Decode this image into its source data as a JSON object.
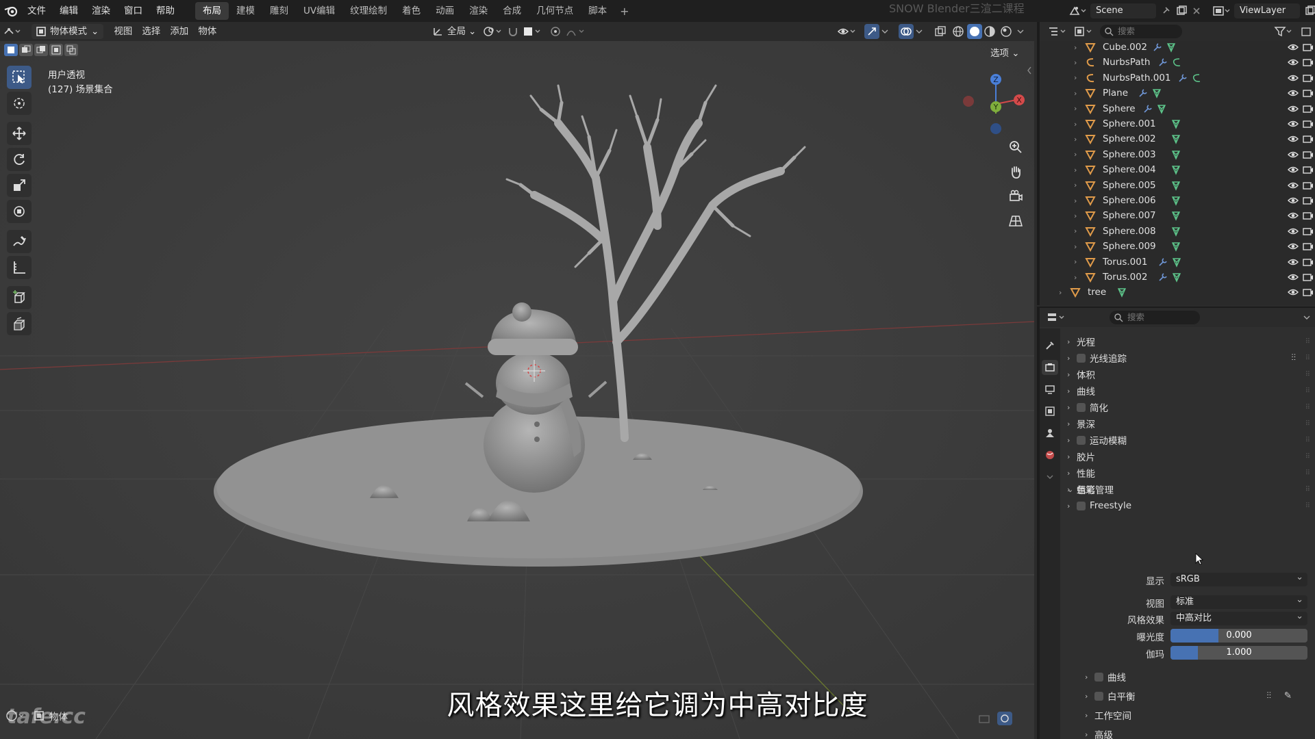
{
  "menubar": {
    "items": [
      "文件",
      "编辑",
      "渲染",
      "窗口",
      "帮助"
    ]
  },
  "workspaces": {
    "tabs": [
      "布局",
      "建模",
      "雕刻",
      "UV编辑",
      "纹理绘制",
      "着色",
      "动画",
      "渲染",
      "合成",
      "几何节点",
      "脚本"
    ],
    "active": "布局",
    "add": "+"
  },
  "watermark_top": "SNOW Blender三渲二课程",
  "scene": {
    "name": "Scene",
    "view_layer": "ViewLayer"
  },
  "viewport_header": {
    "mode": "物体模式",
    "menus": [
      "视图",
      "选择",
      "添加",
      "物体"
    ],
    "orientation": "全局",
    "options": "选项"
  },
  "viewport_info": {
    "line1": "用户透视",
    "line2": "(127) 场景集合"
  },
  "gizmo": {
    "z": "Z",
    "x": "X",
    "y": "Y"
  },
  "outliner": {
    "search_placeholder": "搜索",
    "items": [
      {
        "name": "Cube.002",
        "modifier": true,
        "icon": "mesh"
      },
      {
        "name": "NurbsPath",
        "modifier": true,
        "icon": "curve"
      },
      {
        "name": "NurbsPath.001",
        "modifier": true,
        "icon": "curve"
      },
      {
        "name": "Plane",
        "modifier": true,
        "icon": "mesh"
      },
      {
        "name": "Sphere",
        "modifier": true,
        "icon": "mesh"
      },
      {
        "name": "Sphere.001",
        "modifier": false,
        "icon": "mesh"
      },
      {
        "name": "Sphere.002",
        "modifier": false,
        "icon": "mesh"
      },
      {
        "name": "Sphere.003",
        "modifier": false,
        "icon": "mesh"
      },
      {
        "name": "Sphere.004",
        "modifier": false,
        "icon": "mesh"
      },
      {
        "name": "Sphere.005",
        "modifier": false,
        "icon": "mesh"
      },
      {
        "name": "Sphere.006",
        "modifier": false,
        "icon": "mesh"
      },
      {
        "name": "Sphere.007",
        "modifier": false,
        "icon": "mesh"
      },
      {
        "name": "Sphere.008",
        "modifier": false,
        "icon": "mesh"
      },
      {
        "name": "Sphere.009",
        "modifier": false,
        "icon": "mesh"
      },
      {
        "name": "Torus.001",
        "modifier": true,
        "icon": "mesh"
      },
      {
        "name": "Torus.002",
        "modifier": true,
        "icon": "mesh"
      }
    ],
    "root_item": "tree"
  },
  "properties": {
    "search_placeholder": "搜索",
    "panels": [
      {
        "label": "光程",
        "checkbox": false
      },
      {
        "label": "光线追踪",
        "checkbox": true
      },
      {
        "label": "体积",
        "checkbox": false
      },
      {
        "label": "曲线",
        "checkbox": false
      },
      {
        "label": "简化",
        "checkbox": true
      },
      {
        "label": "景深",
        "checkbox": false
      },
      {
        "label": "运动模糊",
        "checkbox": true
      },
      {
        "label": "胶片",
        "checkbox": false
      },
      {
        "label": "性能",
        "checkbox": false
      },
      {
        "label": "蜡笔",
        "checkbox": false
      },
      {
        "label": "Freestyle",
        "checkbox": true
      }
    ],
    "color_management": {
      "label": "色彩管理",
      "display_label": "显示",
      "display_value": "sRGB",
      "view_label": "视图",
      "view_value": "标准",
      "look_label": "风格效果",
      "look_value": "中高对比",
      "exposure_label": "曝光度",
      "exposure_value": "0.000",
      "exposure_fill": 0.35,
      "gamma_label": "伽玛",
      "gamma_value": "1.000",
      "gamma_fill": 0.2,
      "subpanels": [
        {
          "label": "曲线",
          "checkbox": true
        },
        {
          "label": "白平衡",
          "checkbox": true
        },
        {
          "label": "工作空间",
          "checkbox": false
        },
        {
          "label": "高级",
          "checkbox": false
        }
      ]
    }
  },
  "subtitle": "风格效果这里给它调为中高对比度",
  "bottom_watermark": "tafe.cc",
  "bottom_mode": "物体",
  "colors": {
    "accent": "#4772b3",
    "mesh_icon": "#e09b4a",
    "modifier_icon": "#6f96d6",
    "data_icon": "#5dc48a"
  }
}
